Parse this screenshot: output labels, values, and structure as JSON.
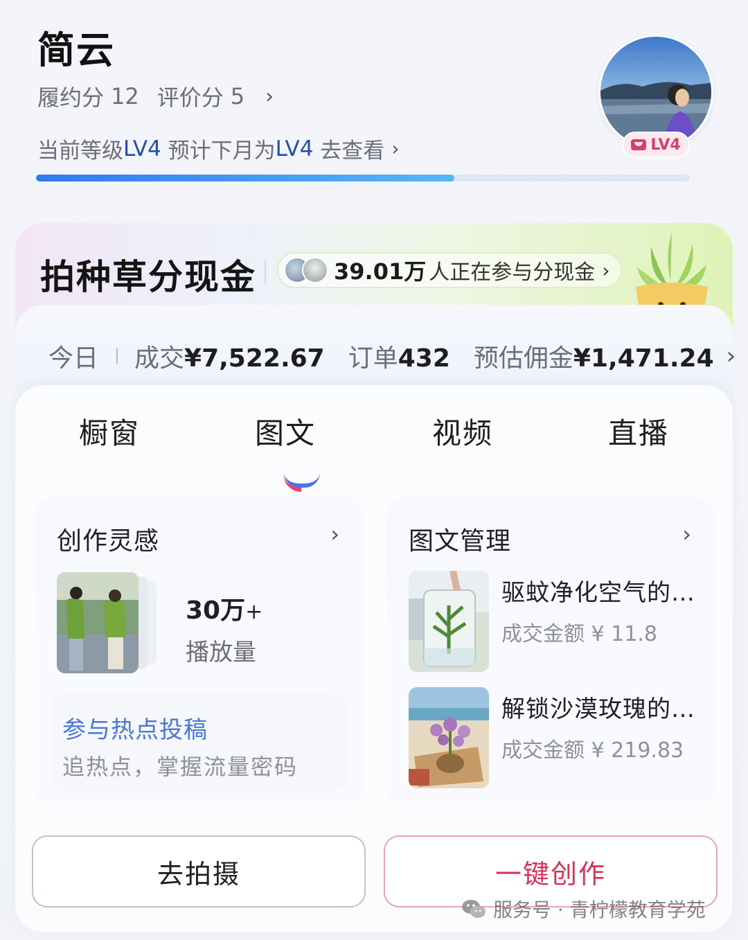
{
  "profile": {
    "name": "简云",
    "fulfillment_label": "履约分",
    "fulfillment_score": "12",
    "review_label": "评价分",
    "review_score": "5",
    "level_prefix": "当前等级",
    "current_level": "LV4",
    "level_mid": " 预计下月为",
    "next_level": "LV4",
    "level_link": " 去查看",
    "level_progress": 0.64,
    "badge_level": "LV4"
  },
  "banner": {
    "title": "拍种草分现金",
    "participants": "39.01万",
    "participants_text": "人正在参与分现金"
  },
  "today": {
    "label": "今日",
    "deal_label": "成交",
    "deal_value": "¥7,522.67",
    "orders_label": "订单",
    "orders_value": "432",
    "commission_label": "预估佣金",
    "commission_value": "¥1,471.24"
  },
  "tabs": [
    {
      "label": "橱窗"
    },
    {
      "label": "图文"
    },
    {
      "label": "视频"
    },
    {
      "label": "直播"
    }
  ],
  "active_tab": "图文",
  "inspiration": {
    "title": "创作灵感",
    "count": "30万",
    "count_suffix": "+",
    "count_label": "播放量",
    "hot_title": "参与热点投稿",
    "hot_subtitle": "追热点，掌握流量密码"
  },
  "post_management": {
    "title": "图文管理",
    "posts": [
      {
        "title": "驱蚊净化空气的…",
        "amount_label": "成交金额",
        "amount": "¥ 11.8"
      },
      {
        "title": "解锁沙漠玫瑰的…",
        "amount_label": "成交金额",
        "amount": "¥ 219.83"
      }
    ]
  },
  "actions": {
    "shoot_label": "去拍摄",
    "create_label": "一键创作"
  },
  "watermark": "服务号 · 青柠檬教育学苑",
  "icons": [
    "chevron-right-icon",
    "wechat-icon",
    "avatar-photo",
    "lv-badge-icon",
    "mascot-icon"
  ],
  "colors": {
    "accent_blue": "#2e7bf0",
    "accent_red": "#d8315b",
    "link_blue": "#4a78cf"
  }
}
